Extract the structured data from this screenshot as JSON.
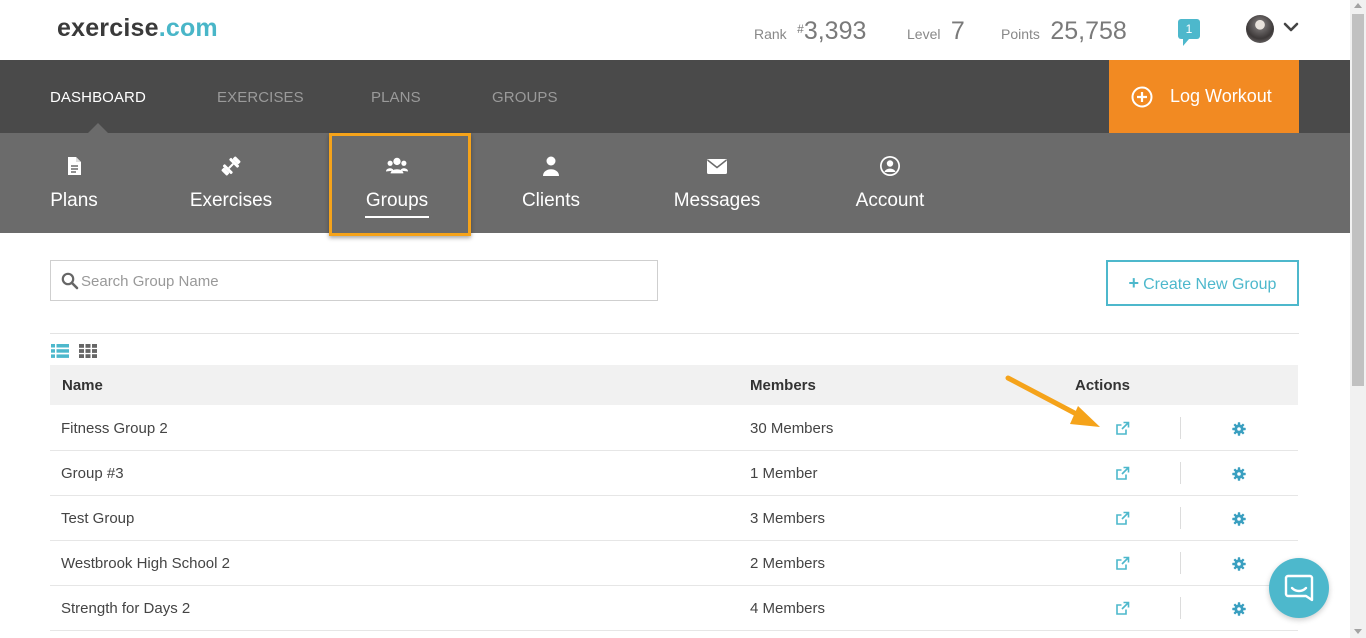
{
  "header": {
    "logo_part1": "exercise",
    "logo_part2": ".com",
    "rank_label": "Rank",
    "rank_prefix": "#",
    "rank_value": "3,393",
    "level_label": "Level",
    "level_value": "7",
    "points_label": "Points",
    "points_value": "25,758",
    "notification_count": "1"
  },
  "nav": {
    "items": [
      {
        "label": "DASHBOARD"
      },
      {
        "label": "EXERCISES"
      },
      {
        "label": "PLANS"
      },
      {
        "label": "GROUPS"
      }
    ],
    "log_workout_label": "Log Workout"
  },
  "subnav": {
    "items": [
      {
        "label": "Plans",
        "icon": "document-icon"
      },
      {
        "label": "Exercises",
        "icon": "dumbbell-icon"
      },
      {
        "label": "Groups",
        "icon": "users-icon"
      },
      {
        "label": "Clients",
        "icon": "user-icon"
      },
      {
        "label": "Messages",
        "icon": "envelope-icon"
      },
      {
        "label": "Account",
        "icon": "account-circle-icon"
      }
    ]
  },
  "search": {
    "placeholder": "Search Group Name",
    "value": ""
  },
  "create_button_label": "Create New Group",
  "table": {
    "columns": {
      "name": "Name",
      "members": "Members",
      "actions": "Actions"
    },
    "rows": [
      {
        "name": "Fitness Group 2",
        "members": "30 Members"
      },
      {
        "name": "Group #3",
        "members": "1 Member"
      },
      {
        "name": "Test Group",
        "members": "3 Members"
      },
      {
        "name": "Westbrook High School 2",
        "members": "2 Members"
      },
      {
        "name": "Strength for Days 2",
        "members": "4 Members"
      }
    ]
  },
  "colors": {
    "accent_teal": "#4db8cc",
    "accent_orange": "#f28a22",
    "nav_dark": "#4a4a4a",
    "subnav_gray": "#6b6b6b",
    "highlight": "#f5a31a"
  }
}
